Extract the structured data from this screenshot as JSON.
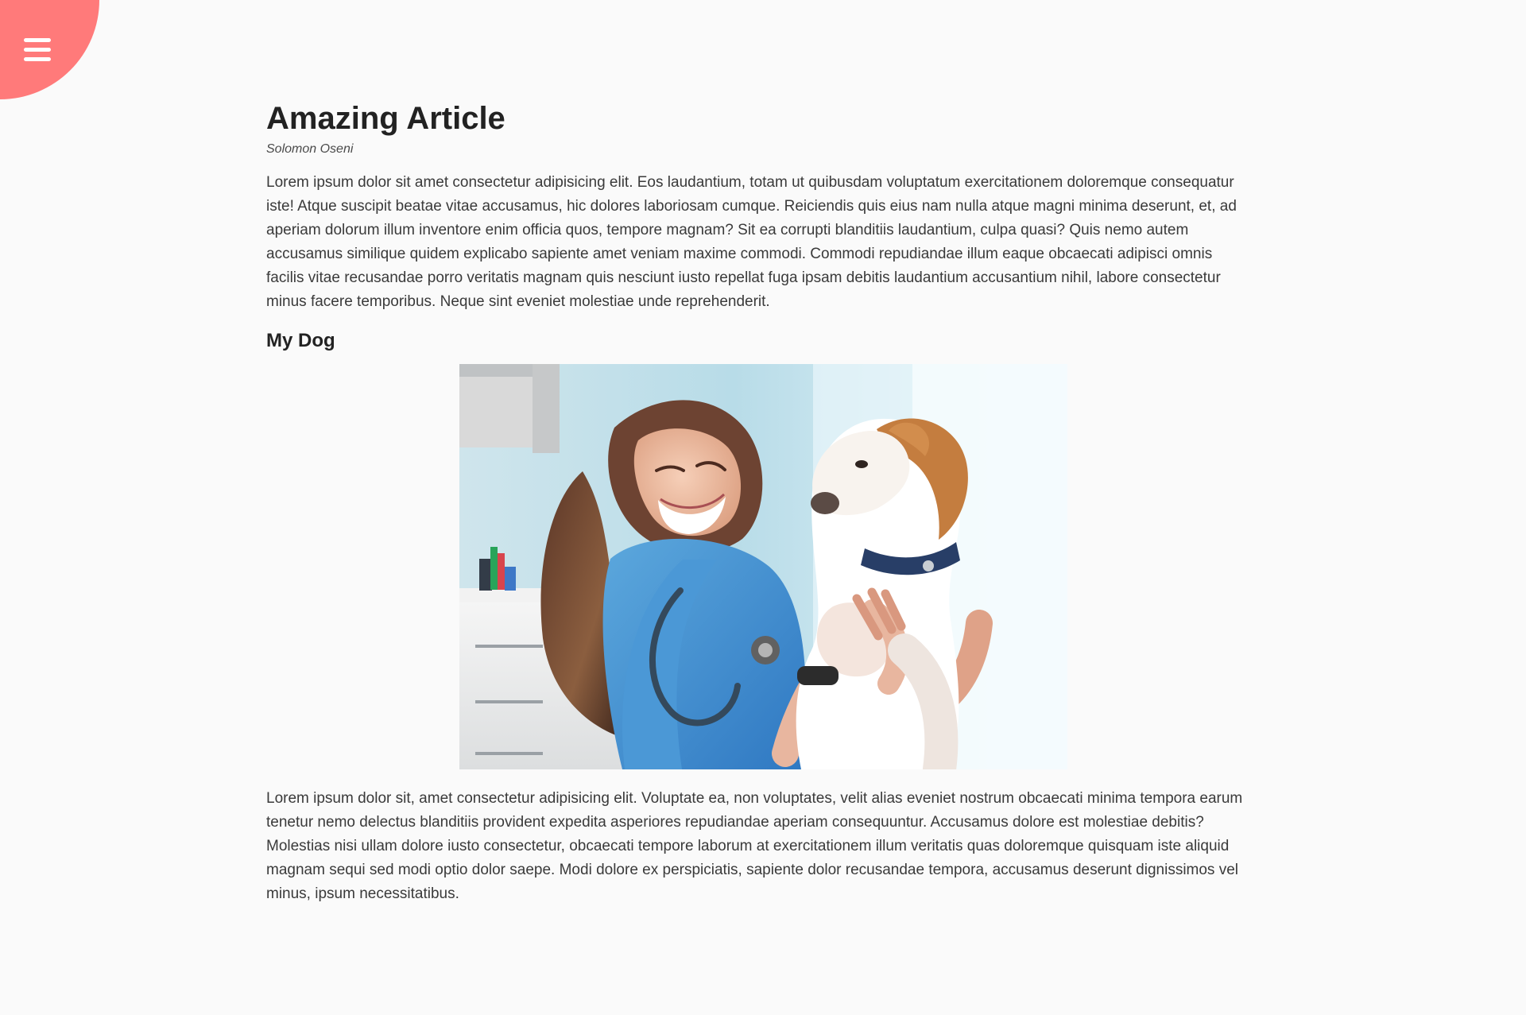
{
  "nav": {
    "menu_icon": "hamburger-menu-icon",
    "accent_color": "#ff7a7a"
  },
  "article": {
    "title": "Amazing Article",
    "author": "Solomon Oseni",
    "intro": "Lorem ipsum dolor sit amet consectetur adipisicing elit. Eos laudantium, totam ut quibusdam voluptatum exercitationem doloremque consequatur iste! Atque suscipit beatae vitae accusamus, hic dolores laboriosam cumque. Reiciendis quis eius nam nulla atque magni minima deserunt, et, ad aperiam dolorum illum inventore enim officia quos, tempore magnam? Sit ea corrupti blanditiis laudantium, culpa quasi? Quis nemo autem accusamus similique quidem explicabo sapiente amet veniam maxime commodi. Commodi repudiandae illum eaque obcaecati adipisci omnis facilis vitae recusandae porro veritatis magnam quis nesciunt iusto repellat fuga ipsam debitis laudantium accusantium nihil, labore consectetur minus facere temporibus. Neque sint eveniet molestiae unde reprehenderit.",
    "section_heading": "My Dog",
    "body": "Lorem ipsum dolor sit, amet consectetur adipisicing elit. Voluptate ea, non voluptates, velit alias eveniet nostrum obcaecati minima tempora earum tenetur nemo delectus blanditiis provident expedita asperiores repudiandae aperiam consequuntur. Accusamus dolore est molestiae debitis? Molestias nisi ullam dolore iusto consectetur, obcaecati tempore laborum at exercitationem illum veritatis quas doloremque quisquam iste aliquid magnam sequi sed modi optio dolor saepe. Modi dolore ex perspiciatis, sapiente dolor recusandae tempora, accusamus deserunt dignissimos vel minus, ipsum necessitatibus."
  }
}
